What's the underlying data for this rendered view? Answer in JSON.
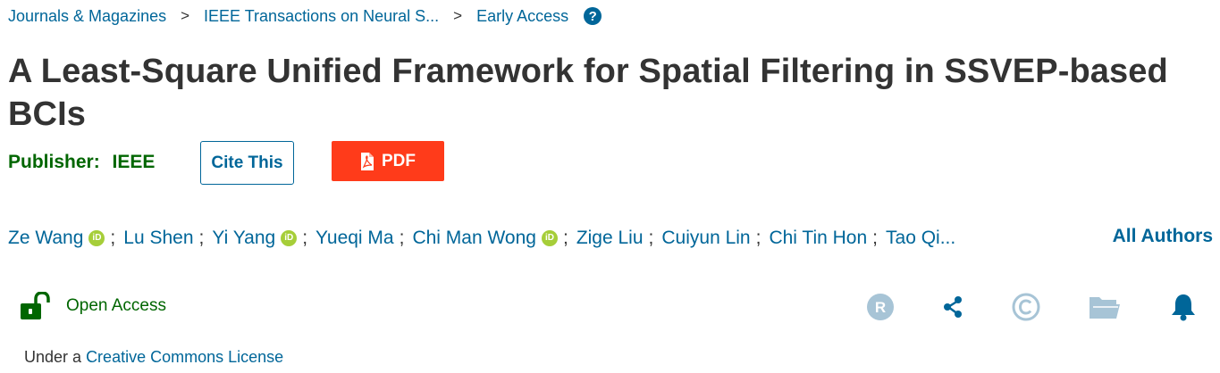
{
  "breadcrumb": {
    "items": [
      "Journals & Magazines",
      "IEEE Transactions on Neural S...",
      "Early Access"
    ],
    "separator": ">"
  },
  "article": {
    "title": "A Least-Square Unified Framework for Spatial Filtering in SSVEP-based BCIs",
    "publisher_label": "Publisher:",
    "publisher_name": "IEEE",
    "cite_label": "Cite This",
    "pdf_label": "PDF"
  },
  "authors": {
    "list": [
      {
        "name": "Ze Wang",
        "orcid": true
      },
      {
        "name": "Lu Shen",
        "orcid": false
      },
      {
        "name": "Yi Yang",
        "orcid": true
      },
      {
        "name": "Yueqi Ma",
        "orcid": false
      },
      {
        "name": "Chi Man Wong",
        "orcid": true
      },
      {
        "name": "Zige Liu",
        "orcid": false
      },
      {
        "name": "Cuiyun Lin",
        "orcid": false
      },
      {
        "name": "Chi Tin Hon",
        "orcid": false
      },
      {
        "name": "Tao Qi...",
        "orcid": false
      }
    ],
    "all_authors_label": "All Authors"
  },
  "access": {
    "open_access_label": "Open Access",
    "license_prefix": "Under a",
    "license_link": "Creative Commons License"
  },
  "toolbar_icons": [
    "rights-icon",
    "share-icon",
    "copyright-icon",
    "folder-icon",
    "alert-bell-icon"
  ],
  "colors": {
    "link": "#006699",
    "publisher_green": "#006600",
    "pdf_red": "#ff3b1a",
    "icon_light_blue": "#a7c4d6",
    "orcid_green": "#a6ce39"
  }
}
